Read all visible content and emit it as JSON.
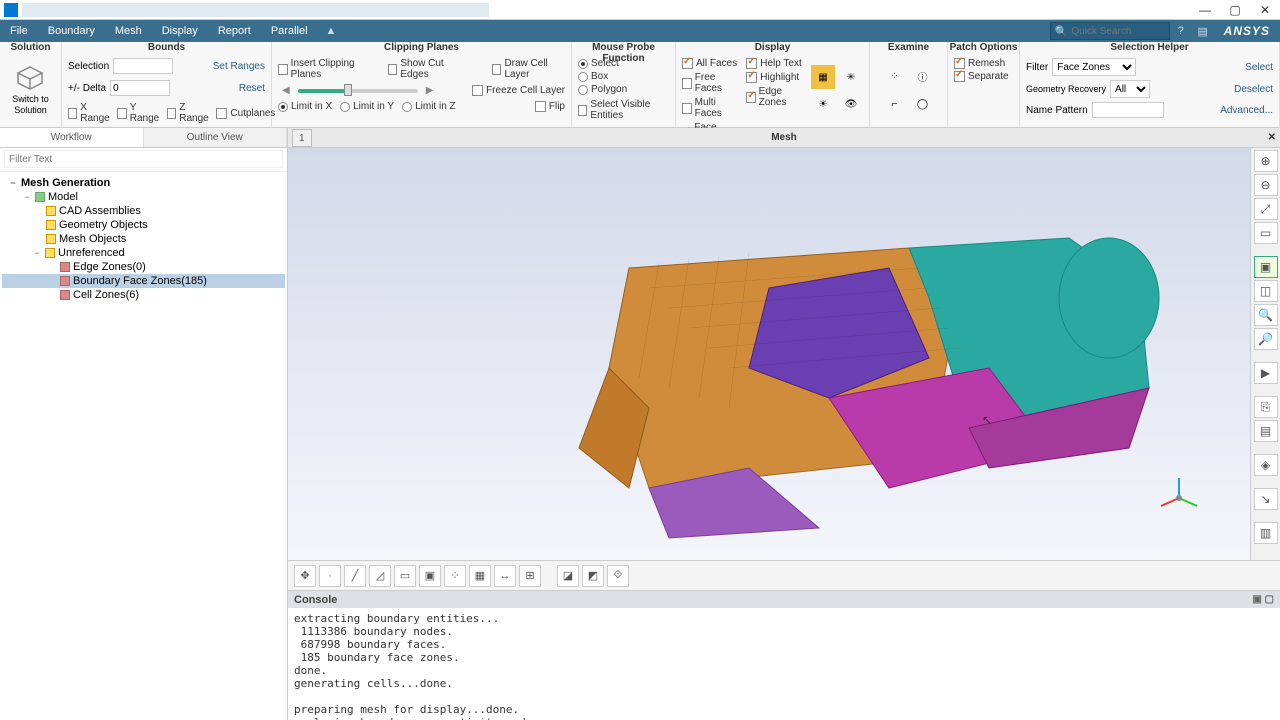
{
  "window": {
    "min": "—",
    "max": "▢",
    "close": "✕"
  },
  "menubar": {
    "items": [
      "File",
      "Boundary",
      "Mesh",
      "Display",
      "Report",
      "Parallel"
    ],
    "search_placeholder": "Quick Search",
    "brand": "ANSYS"
  },
  "ribbon": {
    "solution": {
      "title": "Solution",
      "switch_line1": "Switch to",
      "switch_line2": "Solution"
    },
    "bounds": {
      "title": "Bounds",
      "selection": "Selection",
      "set_ranges": "Set Ranges",
      "delta_label": "+/- Delta",
      "delta_value": "0",
      "reset": "Reset",
      "xrange": "X Range",
      "yrange": "Y Range",
      "zrange": "Z Range",
      "cutplanes": "Cutplanes"
    },
    "clipping": {
      "title": "Clipping Planes",
      "insert": "Insert Clipping Planes",
      "showcut": "Show Cut Edges",
      "limitx": "Limit in X",
      "limity": "Limit in Y",
      "limitz": "Limit in Z",
      "drawcell": "Draw Cell Layer",
      "freezecell": "Freeze Cell Layer",
      "flip": "Flip"
    },
    "probe": {
      "title": "Mouse Probe Function",
      "select": "Select",
      "box": "Box",
      "polygon": "Polygon",
      "svisible": "Select Visible Entities"
    },
    "display": {
      "title": "Display",
      "allfaces": "All Faces",
      "freefaces": "Free Faces",
      "multifaces": "Multi Faces",
      "faceedges": "Face Edges",
      "helptext": "Help Text",
      "highlight": "Highlight",
      "edgezones": "Edge Zones"
    },
    "examine": {
      "title": "Examine"
    },
    "patch": {
      "title": "Patch Options",
      "remesh": "Remesh",
      "separate": "Separate"
    },
    "selhelper": {
      "title": "Selection Helper",
      "filter": "Filter",
      "filter_value": "Face Zones",
      "select": "Select",
      "geom": "Geometry Recovery",
      "geom_value": "All",
      "deselect": "Deselect",
      "namepat": "Name Pattern",
      "advanced": "Advanced..."
    }
  },
  "tree_tabs": {
    "workflow": "Workflow",
    "outline": "Outline View"
  },
  "filter_placeholder": "Filter Text",
  "tree": {
    "root": "Mesh Generation",
    "model": "Model",
    "cad": "CAD Assemblies",
    "geom": "Geometry Objects",
    "mesh": "Mesh Objects",
    "unref": "Unreferenced",
    "edge": "Edge Zones(0)",
    "bface": "Boundary Face Zones(185)",
    "cell": "Cell Zones(6)"
  },
  "gfx": {
    "label": "Mesh",
    "tab": "1"
  },
  "console": {
    "title": "Console",
    "text": "extracting boundary entities...\n 1113386 boundary nodes.\n 687998 boundary faces.\n 185 boundary face zones.\ndone.\ngenerating cells...done.\n\npreparing mesh for display...done.\nanalyzing boundary connectivity...done."
  }
}
